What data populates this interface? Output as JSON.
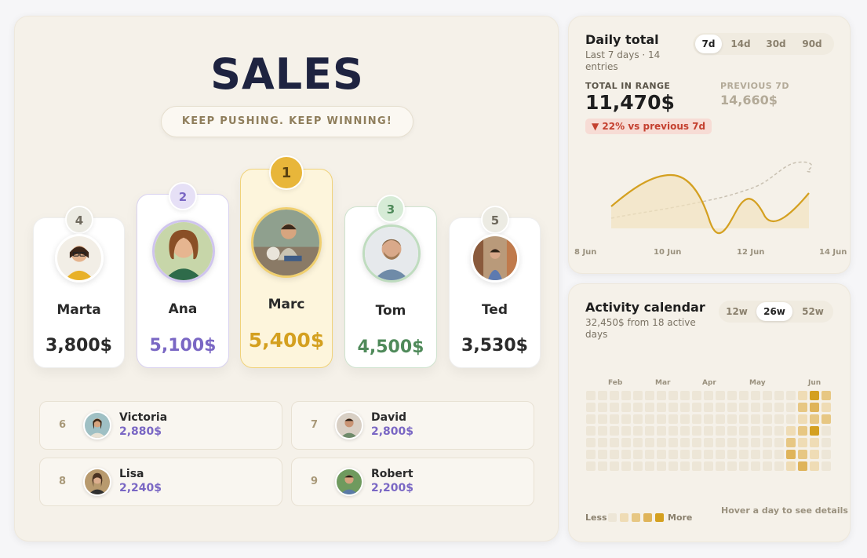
{
  "header": {
    "title": "SALES",
    "tagline": "KEEP PUSHING. KEEP WINNING!"
  },
  "podium": [
    {
      "rank": "4",
      "name": "Marta",
      "amount": "3,800$",
      "accent": "#2a2a2a",
      "avatar_icon": "person-glasses-avatar"
    },
    {
      "rank": "2",
      "name": "Ana",
      "amount": "5,100$",
      "accent": "#7a67c4",
      "avatar_icon": "person-curly-avatar"
    },
    {
      "rank": "1",
      "name": "Marc",
      "amount": "5,400$",
      "accent": "#d4a020",
      "avatar_icon": "person-outdoor-avatar"
    },
    {
      "rank": "3",
      "name": "Tom",
      "amount": "4,500$",
      "accent": "#4f8a5a",
      "avatar_icon": "person-beard-avatar"
    },
    {
      "rank": "5",
      "name": "Ted",
      "amount": "3,530$",
      "accent": "#2a2a2a",
      "avatar_icon": "person-street-avatar"
    }
  ],
  "leaderboard": [
    {
      "rank": "6",
      "name": "Victoria",
      "amount": "2,880$"
    },
    {
      "rank": "7",
      "name": "David",
      "amount": "2,800$"
    },
    {
      "rank": "8",
      "name": "Lisa",
      "amount": "2,240$"
    },
    {
      "rank": "9",
      "name": "Robert",
      "amount": "2,200$"
    }
  ],
  "daily": {
    "title": "Daily total",
    "subtitle_line1": "Last 7 days · 14",
    "subtitle_line2": "entries",
    "ranges": [
      "7d",
      "14d",
      "30d",
      "90d"
    ],
    "active_range": "7d",
    "total_label": "TOTAL IN RANGE",
    "total_value": "11,470$",
    "previous_label": "PREVIOUS 7D",
    "previous_value": "14,660$",
    "change_pct": "22%",
    "change_text": "vs previous 7d",
    "x_ticks": [
      "8 Jun",
      "10 Jun",
      "12 Jun",
      "14 Jun"
    ]
  },
  "calendar": {
    "title": "Activity calendar",
    "subtitle_line1": "32,450$ from 18 active",
    "subtitle_line2": "days",
    "ranges": [
      "12w",
      "26w",
      "52w"
    ],
    "active_range": "26w",
    "months": [
      "Feb",
      "Mar",
      "Apr",
      "May",
      "Jun"
    ],
    "legend_less": "Less",
    "legend_more": "More",
    "hint": "Hover a day to see details"
  },
  "colors": {
    "brand_dark": "#1e2340",
    "gold": "#d4a020",
    "purple": "#7a67c4",
    "green": "#4f8a5a",
    "negative": "#c4402f"
  }
}
